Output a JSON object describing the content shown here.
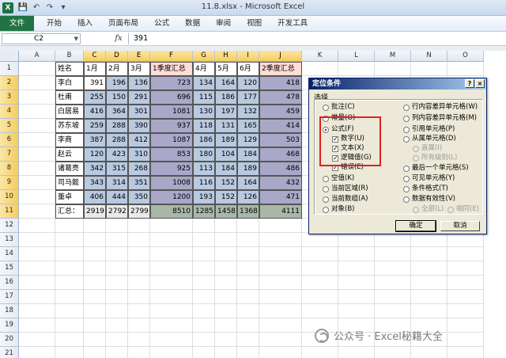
{
  "window": {
    "title": "11.8.xlsx - Microsoft Excel",
    "app_icon": "X"
  },
  "qat": [
    "save-icon",
    "undo-icon",
    "redo-icon",
    "customize-icon"
  ],
  "ribbon": {
    "tabs": [
      "文件",
      "开始",
      "插入",
      "页面布局",
      "公式",
      "数据",
      "审阅",
      "视图",
      "开发工具"
    ]
  },
  "formula_bar": {
    "name_box": "C2",
    "fx": "fx",
    "value": "391"
  },
  "columns": [
    "A",
    "B",
    "C",
    "D",
    "E",
    "F",
    "G",
    "H",
    "I",
    "J",
    "K",
    "L",
    "M",
    "N",
    "O"
  ],
  "rows": [
    "1",
    "2",
    "3",
    "4",
    "5",
    "6",
    "7",
    "8",
    "9",
    "10",
    "11",
    "12",
    "13",
    "14",
    "15",
    "16",
    "17",
    "18",
    "19",
    "20",
    "21"
  ],
  "table": {
    "header": [
      "姓名",
      "1月",
      "2月",
      "3月",
      "1季度汇总",
      "4月",
      "5月",
      "6月",
      "2季度汇总"
    ],
    "data": [
      [
        "李白",
        "391",
        "196",
        "136",
        "723",
        "134",
        "164",
        "120",
        "418"
      ],
      [
        "杜甫",
        "255",
        "150",
        "291",
        "696",
        "115",
        "186",
        "177",
        "478"
      ],
      [
        "白居易",
        "416",
        "364",
        "301",
        "1081",
        "130",
        "197",
        "132",
        "459"
      ],
      [
        "苏东坡",
        "259",
        "288",
        "390",
        "937",
        "118",
        "131",
        "165",
        "414"
      ],
      [
        "李商",
        "387",
        "288",
        "412",
        "1087",
        "186",
        "189",
        "129",
        "503"
      ],
      [
        "赵云",
        "120",
        "423",
        "310",
        "853",
        "180",
        "104",
        "184",
        "468"
      ],
      [
        "诸葛亮",
        "342",
        "315",
        "268",
        "925",
        "113",
        "184",
        "189",
        "486"
      ],
      [
        "司马懿",
        "343",
        "314",
        "351",
        "1008",
        "116",
        "152",
        "164",
        "432"
      ],
      [
        "董卓",
        "406",
        "444",
        "350",
        "1200",
        "193",
        "152",
        "126",
        "471"
      ]
    ],
    "total": [
      "汇总：",
      "2919",
      "2792",
      "2799",
      "8510",
      "1285",
      "1458",
      "1368",
      "4111"
    ]
  },
  "dialog": {
    "title": "定位条件",
    "title_buttons": [
      "?",
      "×"
    ],
    "group_label": "选择",
    "left_options": [
      {
        "label": "批注(C)",
        "type": "radio",
        "checked": false
      },
      {
        "label": "常量(O)",
        "type": "radio",
        "checked": false
      },
      {
        "label": "公式(F)",
        "type": "radio",
        "checked": true
      },
      {
        "label": "数字(U)",
        "type": "check",
        "checked": true
      },
      {
        "label": "文本(X)",
        "type": "check",
        "checked": true
      },
      {
        "label": "逻辑值(G)",
        "type": "check",
        "checked": true
      },
      {
        "label": "错误(E)",
        "type": "check",
        "checked": true
      },
      {
        "label": "空值(K)",
        "type": "radio",
        "checked": false
      },
      {
        "label": "当前区域(R)",
        "type": "radio",
        "checked": false
      },
      {
        "label": "当前数组(A)",
        "type": "radio",
        "checked": false
      },
      {
        "label": "对象(B)",
        "type": "radio",
        "checked": false
      }
    ],
    "right_options": [
      {
        "label": "行内容差异单元格(W)",
        "type": "radio",
        "disabled": false
      },
      {
        "label": "列内容差异单元格(M)",
        "type": "radio",
        "disabled": false
      },
      {
        "label": "引用单元格(P)",
        "type": "radio",
        "disabled": false
      },
      {
        "label": "从属单元格(D)",
        "type": "radio",
        "disabled": false
      },
      {
        "label": "直属(I)",
        "type": "radio",
        "disabled": true
      },
      {
        "label": "所有级别(L)",
        "type": "radio",
        "disabled": true
      },
      {
        "label": "最后一个单元格(S)",
        "type": "radio",
        "disabled": false
      },
      {
        "label": "可见单元格(Y)",
        "type": "radio",
        "disabled": false
      },
      {
        "label": "条件格式(T)",
        "type": "radio",
        "disabled": false
      },
      {
        "label": "数据有效性(V)",
        "type": "radio",
        "disabled": false
      },
      {
        "label": "全部(L)",
        "type": "radio",
        "disabled": true
      },
      {
        "label": "相同(E)",
        "type": "radio",
        "disabled": true
      }
    ],
    "ok_label": "确定",
    "cancel_label": "取消"
  },
  "watermark": "公众号 · Excel秘籍大全"
}
